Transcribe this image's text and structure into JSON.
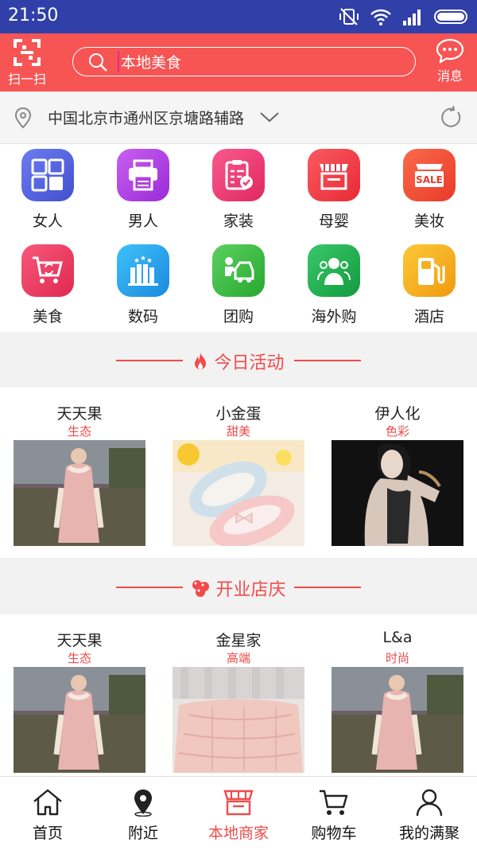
{
  "status": {
    "time": "21:50"
  },
  "header": {
    "scan_label": "扫一扫",
    "search_value": "本地美食",
    "message_label": "消息"
  },
  "location": {
    "address": "中国北京市通州区京塘路辅路"
  },
  "categories": [
    {
      "label": "女人",
      "icon": "grid-icon",
      "color": "#5a67e8"
    },
    {
      "label": "男人",
      "icon": "printer-icon",
      "color": "#b040e0"
    },
    {
      "label": "家装",
      "icon": "clipboard-icon",
      "color": "#f0407a"
    },
    {
      "label": "母婴",
      "icon": "shop-icon",
      "color": "#f5404a"
    },
    {
      "label": "美妆",
      "icon": "sale-tag-icon",
      "color": "#f5503a",
      "badge": "SALE"
    },
    {
      "label": "美食",
      "icon": "cart-icon",
      "color": "#f0405a"
    },
    {
      "label": "数码",
      "icon": "buildings-icon",
      "color": "#2aa8e8"
    },
    {
      "label": "团购",
      "icon": "car-icon",
      "color": "#3cc040"
    },
    {
      "label": "海外购",
      "icon": "people-icon",
      "color": "#1fae4a"
    },
    {
      "label": "酒店",
      "icon": "fuel-icon",
      "color": "#f5b020"
    }
  ],
  "sections": [
    {
      "title": "今日活动",
      "icon": "flame-icon",
      "items": [
        {
          "name": "天天果",
          "tag": "生态",
          "image": "pink-coat"
        },
        {
          "name": "小金蛋",
          "tag": "甜美",
          "image": "baby-shoes"
        },
        {
          "name": "伊人化",
          "tag": "色彩",
          "image": "model-portrait"
        }
      ]
    },
    {
      "title": "开业店庆",
      "icon": "balloons-icon",
      "items": [
        {
          "name": "天天果",
          "tag": "生态",
          "image": "pink-coat"
        },
        {
          "name": "金星家",
          "tag": "高端",
          "image": "pink-quilt"
        },
        {
          "name": "L&a",
          "tag": "时尚",
          "image": "pink-coat"
        }
      ]
    }
  ],
  "tabs": [
    {
      "label": "首页",
      "icon": "home-icon"
    },
    {
      "label": "附近",
      "icon": "location-icon"
    },
    {
      "label": "本地商家",
      "icon": "store-icon",
      "active": true
    },
    {
      "label": "购物车",
      "icon": "cart-icon"
    },
    {
      "label": "我的满聚",
      "icon": "user-icon"
    }
  ]
}
